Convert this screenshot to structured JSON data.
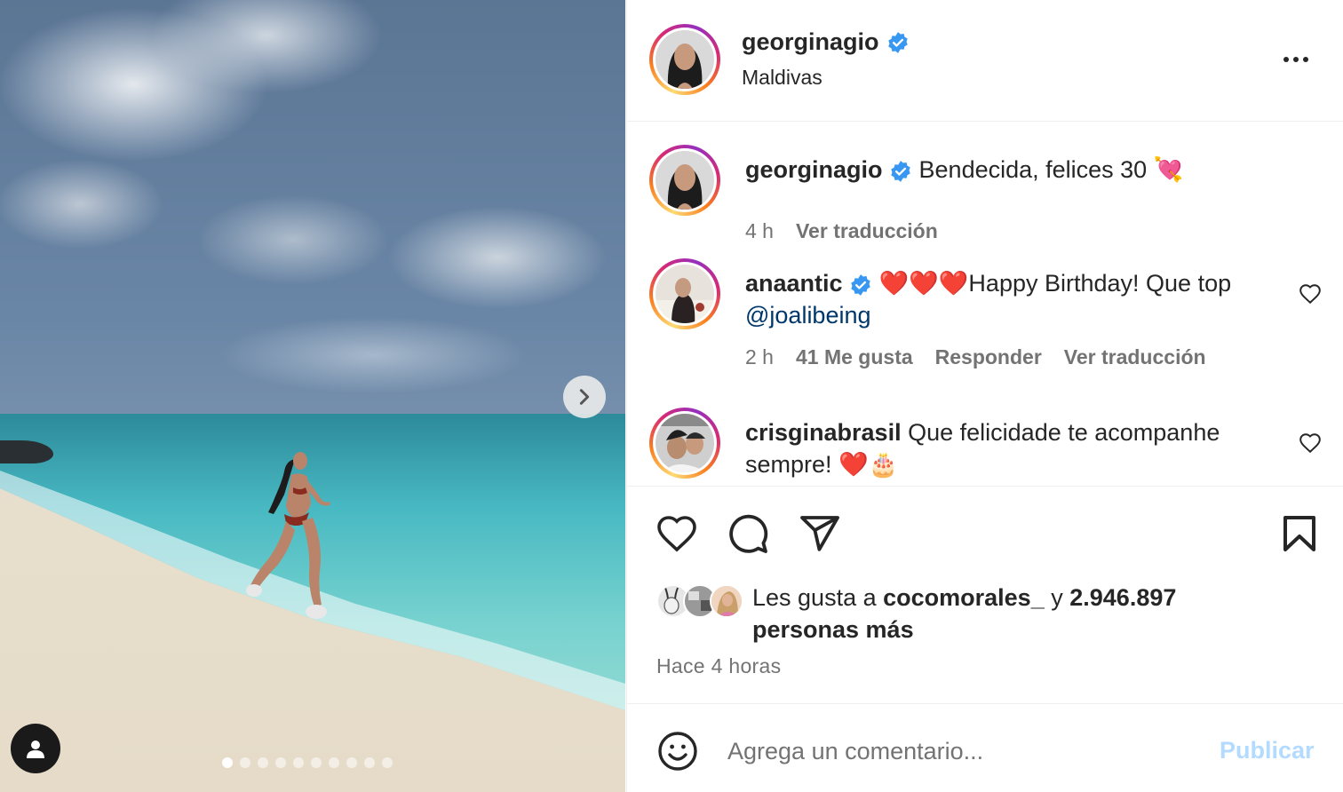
{
  "post": {
    "username": "georginagio",
    "location": "Maldivas",
    "carousel_total": 10,
    "carousel_current": 1
  },
  "comments": [
    {
      "username": "georginagio",
      "text": "Bendecida, felices 30 💘",
      "time": "4 h",
      "translate": "Ver traducción"
    },
    {
      "username": "anaantic",
      "text": "❤️❤️❤️Happy Birthday! Que top ",
      "mention": "@joalibeing",
      "time": "2 h",
      "likes": "41 Me gusta",
      "reply": "Responder",
      "translate": "Ver traducción"
    },
    {
      "username": "crisginabrasil",
      "text": "Que felicidade te acompanhe sempre! ❤️🎂"
    }
  ],
  "likes": {
    "prefix": "Les gusta a",
    "user": "cocomorales_",
    "connector": "y",
    "count_text": "2.946.897 personas más"
  },
  "time_ago": "Hace 4 horas",
  "add_comment": {
    "placeholder": "Agrega un comentario...",
    "publish": "Publicar"
  },
  "icons": {
    "header_more": "more-horizontal-icon",
    "verified": "verified-badge-icon",
    "comment_like": "heart-outline-icon",
    "like": "heart-outline-icon",
    "comment": "speech-bubble-icon",
    "share": "paper-plane-icon",
    "save": "bookmark-icon",
    "emoji": "smiley-icon",
    "carousel_next": "chevron-right-icon",
    "tags": "user-silhouette-icon"
  },
  "colors": {
    "verified_blue": "#3897f0",
    "mention": "#00376b",
    "publish_disabled": "#b3dbff",
    "secondary_text": "#737373"
  }
}
